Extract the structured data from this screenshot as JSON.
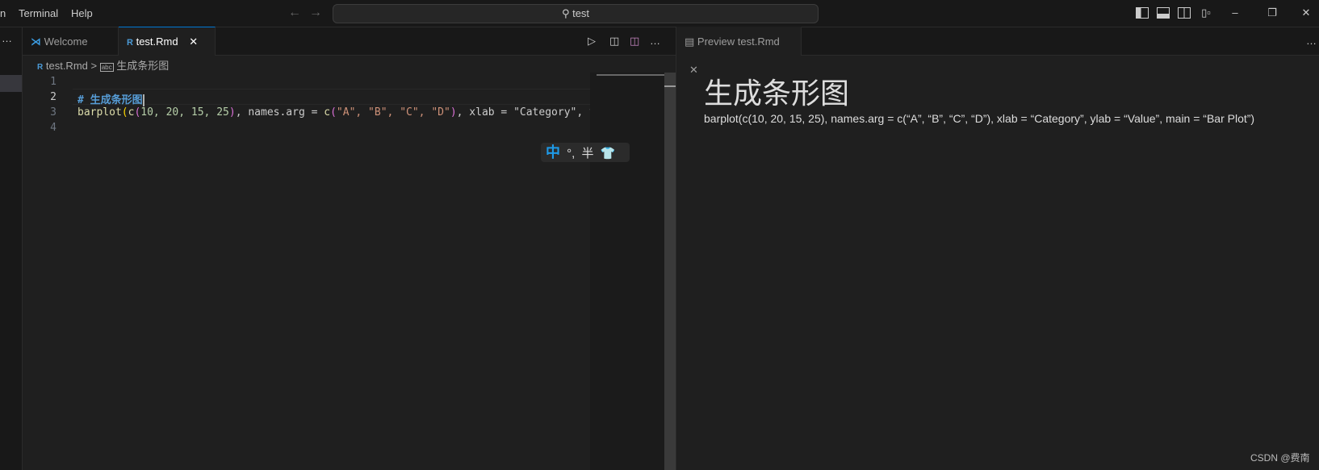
{
  "titlebar": {
    "menu": [
      "n",
      "Terminal",
      "Help"
    ],
    "search": "test",
    "icons": [
      "toggle-primary-sidebar-icon",
      "toggle-panel-icon",
      "toggle-secondary-sidebar-icon",
      "customize-layout-icon"
    ],
    "window": [
      "minimize",
      "restore",
      "close"
    ]
  },
  "tabs": [
    {
      "label": "Welcome",
      "icon": "vscode-logo"
    },
    {
      "label": "test.Rmd",
      "icon": "r-icon",
      "active": true
    }
  ],
  "editor_actions": [
    "run-icon",
    "open-preview-icon",
    "split-editor-icon",
    "more-icon"
  ],
  "breadcrumb": {
    "file": "test.Rmd",
    "sep": ">",
    "section": "生成条形图"
  },
  "code": {
    "line_numbers": [
      "1",
      "2",
      "3",
      "4"
    ],
    "line2_hash": "# ",
    "line2_text": "生成条形图",
    "line3": [
      "barplot",
      "(",
      "c",
      "(",
      "10, 20, 15, 25",
      ")",
      ", names.arg = ",
      "c",
      "(",
      "\"A\", \"B\", \"C\", \"D\"",
      ")",
      ", xlab = \"Category\", yl"
    ]
  },
  "preview": {
    "tab": "Preview test.Rmd",
    "heading": "生成条形图",
    "paragraph": "barplot(c(10, 20, 15, 25), names.arg = c(“A”, “B”, “C”, “D”), xlab = “Category”, ylab = “Value”, main = “Bar Plot”)"
  },
  "ime": {
    "mode": "中",
    "punct": "°,",
    "width": "半"
  },
  "watermark": "CSDN @费南",
  "colors": {
    "accent": "#0078d4",
    "heading_md": "#569cd6",
    "bracket1": "#ffd700",
    "bracket2": "#da70d6",
    "string": "#ce9178",
    "number": "#b5cea8"
  }
}
